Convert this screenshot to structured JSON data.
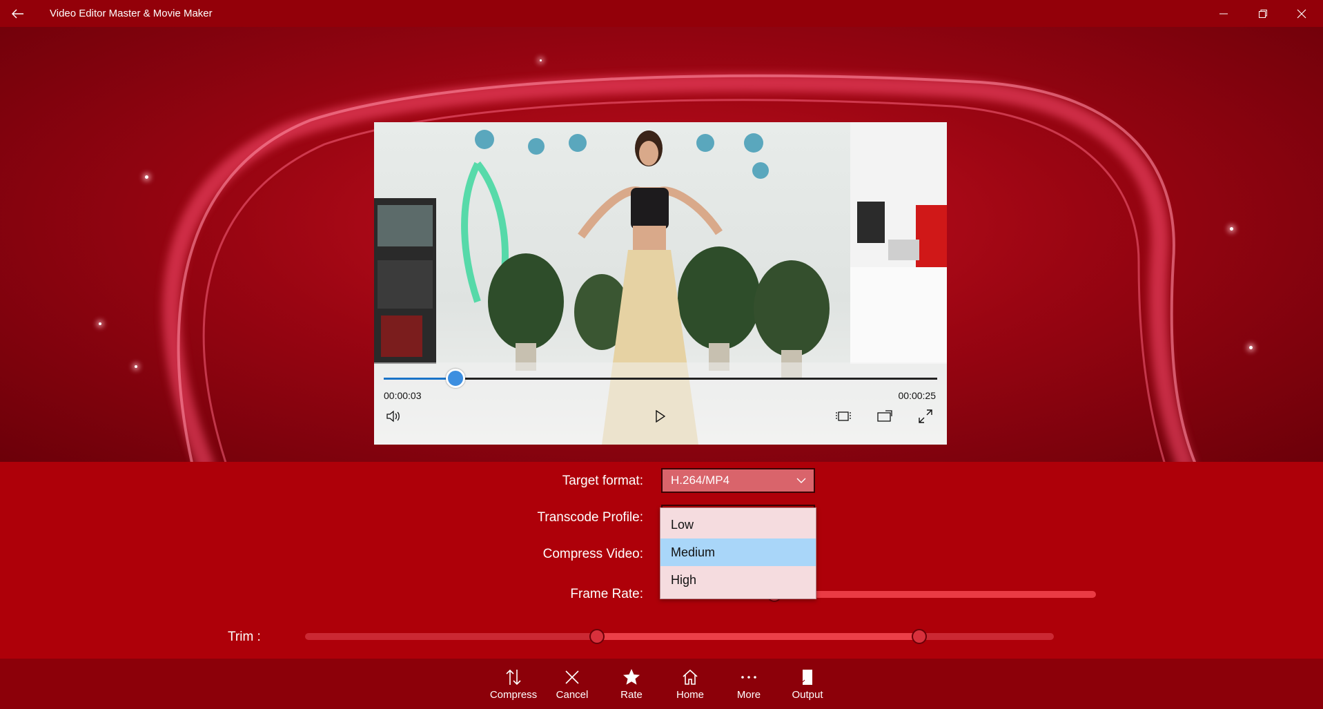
{
  "window": {
    "title": "Video Editor Master & Movie Maker",
    "back_icon": "back-arrow-icon",
    "minimize_icon": "minimize-icon",
    "restore_icon": "restore-icon",
    "close_icon": "close-icon"
  },
  "player": {
    "current_time": "00:00:03",
    "total_time": "00:00:25",
    "progress": 0.13,
    "icons": [
      "volume-icon",
      "play-icon",
      "aspect-ratio-icon",
      "cast-icon",
      "fullscreen-icon"
    ]
  },
  "settings": {
    "target_format_label": "Target format:",
    "target_format_value": "H.264/MP4",
    "transcode_profile_label": "Transcode Profile:",
    "compress_video_label": "Compress Video:",
    "frame_rate_label": "Frame Rate:",
    "trim_label": "Trim :",
    "profile_options": [
      "Low",
      "Medium",
      "High"
    ],
    "profile_selected": "Medium",
    "frame_rate_level": 0.25,
    "trim_start": 0.39,
    "trim_end": 0.82
  },
  "appbar": {
    "buttons": [
      {
        "label": "Compress",
        "icon": "compress-icon"
      },
      {
        "label": "Cancel",
        "icon": "cancel-icon"
      },
      {
        "label": "Rate",
        "icon": "star-icon"
      },
      {
        "label": "Home",
        "icon": "home-icon"
      },
      {
        "label": "More",
        "icon": "more-icon"
      },
      {
        "label": "Output",
        "icon": "output-icon"
      }
    ]
  },
  "colors": {
    "accent": "#ae0009",
    "titlebar": "#930009",
    "appbar": "#8c0009",
    "seek_fill": "#1a73c8",
    "dropdown_selected": "#a9d6f9"
  }
}
